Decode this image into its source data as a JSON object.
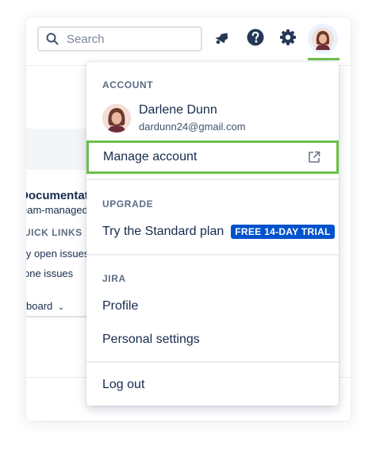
{
  "header": {
    "search_placeholder": "Search",
    "icons": [
      "search-icon",
      "notifications-icon",
      "help-icon",
      "settings-icon",
      "avatar"
    ],
    "accent_color": "#6cc04a"
  },
  "background": {
    "project_title": "Documentat",
    "project_subtitle": "eam-managed",
    "quick_links_heading": "UICK LINKS",
    "quick_links": [
      "ly open issues",
      "one issues"
    ],
    "board_selector": "board"
  },
  "dropdown": {
    "account": {
      "heading": "ACCOUNT",
      "user_name": "Darlene Dunn",
      "user_email": "dardunn24@gmail.com",
      "manage_label": "Manage account"
    },
    "upgrade": {
      "heading": "UPGRADE",
      "item_label": "Try the Standard plan",
      "badge": "FREE 14-DAY TRIAL",
      "badge_color": "#0052cc"
    },
    "jira": {
      "heading": "JIRA",
      "items": [
        "Profile",
        "Personal settings"
      ]
    },
    "logout_label": "Log out"
  }
}
